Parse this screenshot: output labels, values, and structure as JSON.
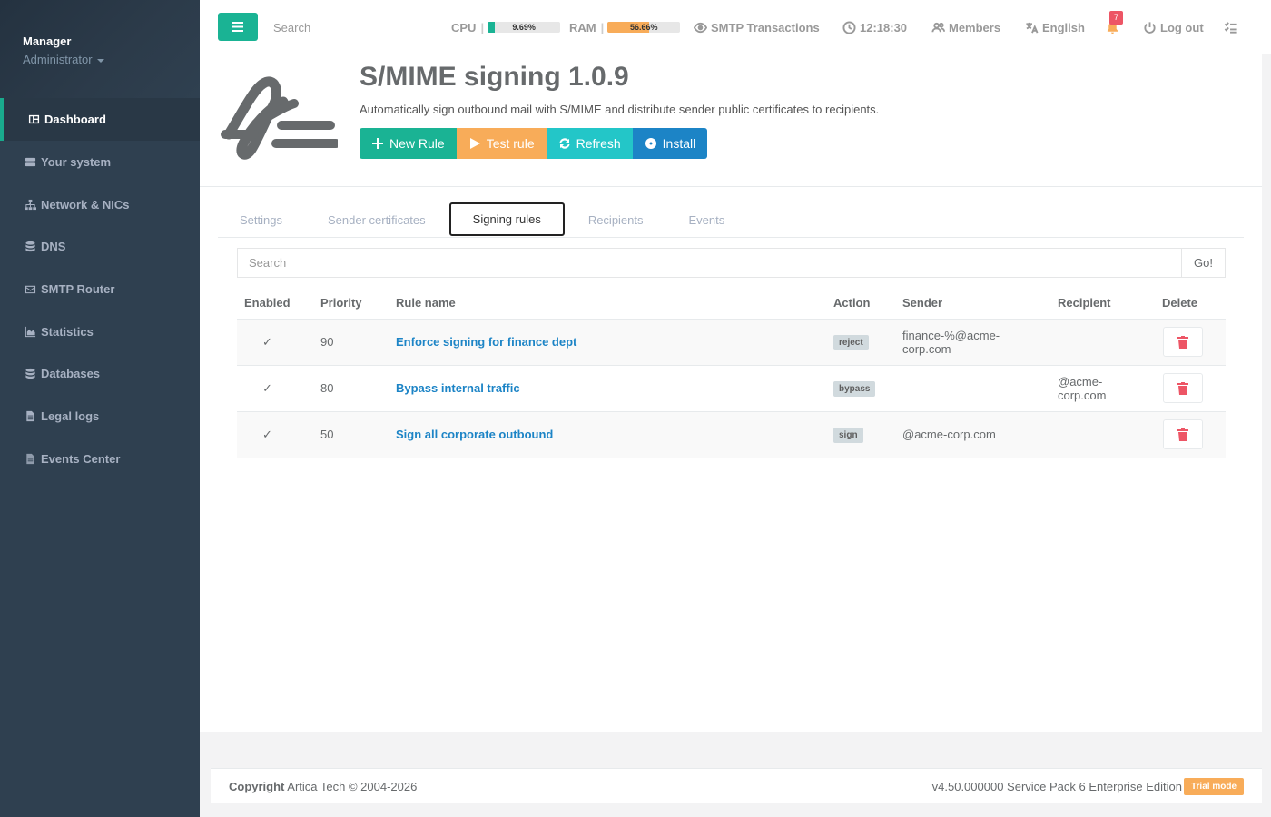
{
  "sidebar": {
    "user_name": "Manager",
    "user_role": "Administrator",
    "items": [
      {
        "label": "Dashboard",
        "icon": "dashboard-icon"
      },
      {
        "label": "Your system",
        "icon": "server-icon"
      },
      {
        "label": "Network & NICs",
        "icon": "network-icon"
      },
      {
        "label": "DNS",
        "icon": "database-icon"
      },
      {
        "label": "SMTP Router",
        "icon": "envelope-icon"
      },
      {
        "label": "Statistics",
        "icon": "area-chart-icon"
      },
      {
        "label": "Databases",
        "icon": "database-icon"
      },
      {
        "label": "Legal logs",
        "icon": "file-icon"
      },
      {
        "label": "Events Center",
        "icon": "file-text-icon"
      }
    ]
  },
  "topbar": {
    "search_placeholder": "Search",
    "cpu_label": "CPU",
    "cpu_value": "9.69%",
    "cpu_fraction": 0.0969,
    "cpu_color": "#1ab394",
    "ram_label": "RAM",
    "ram_value": "56.66%",
    "ram_fraction": 0.5666,
    "ram_color": "#f8ac59",
    "smtp_label": "SMTP Transactions",
    "time": "12:18:30",
    "members_label": "Members",
    "language_label": "English",
    "notifications_count": "7",
    "logout_label": "Log out"
  },
  "header": {
    "title": "S/MIME signing 1.0.9",
    "description": "Automatically sign outbound mail with S/MIME and distribute sender public certificates to recipients.",
    "buttons": {
      "new_rule": "New Rule",
      "test_rule": "Test rule",
      "refresh": "Refresh",
      "install": "Install"
    }
  },
  "tabs": [
    "Settings",
    "Sender certificates",
    "Signing rules",
    "Recipients",
    "Events"
  ],
  "active_tab": "Signing rules",
  "rules_search": {
    "placeholder": "Search",
    "go_label": "Go!"
  },
  "table": {
    "columns": [
      "Enabled",
      "Priority",
      "Rule name",
      "Action",
      "Sender",
      "Recipient",
      "Delete"
    ],
    "rows": [
      {
        "enabled": "✓",
        "priority": "90",
        "name": "Enforce signing for finance dept",
        "action": "reject",
        "sender": "finance-%@acme-corp.com",
        "recipient": ""
      },
      {
        "enabled": "✓",
        "priority": "80",
        "name": "Bypass internal traffic",
        "action": "bypass",
        "sender": "",
        "recipient": "@acme-corp.com"
      },
      {
        "enabled": "✓",
        "priority": "50",
        "name": "Sign all corporate outbound",
        "action": "sign",
        "sender": "@acme-corp.com",
        "recipient": ""
      }
    ]
  },
  "footer": {
    "copyright_bold": "Copyright",
    "copyright_text": "Artica Tech © 2004-2026",
    "version": "v4.50.000000 Service Pack 6 Enterprise Edition",
    "trial_label": "Trial mode"
  },
  "colors": {
    "sidebar_bg": "#2f4050",
    "accent_green": "#1ab394",
    "link_blue": "#1c84c6",
    "orange": "#f8ac59",
    "cyan": "#23c6c8",
    "danger_red": "#ed5565"
  }
}
